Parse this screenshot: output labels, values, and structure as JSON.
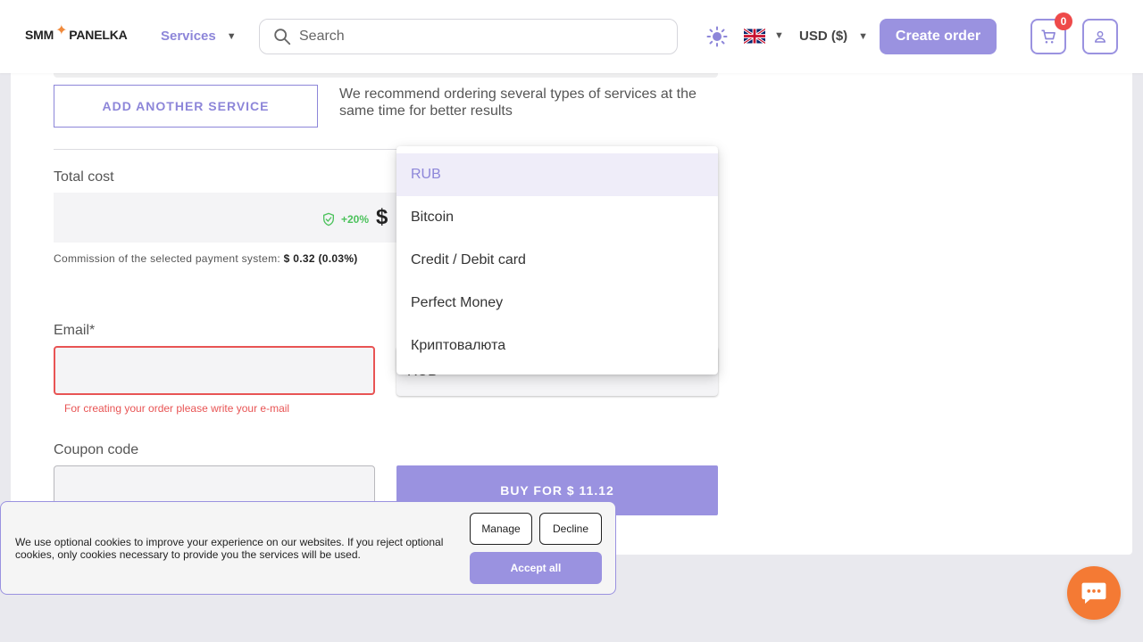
{
  "header": {
    "logo_left": "SMM",
    "logo_right": "PANELKA",
    "services_label": "Services",
    "search_placeholder": "Search",
    "currency_label": "USD ($)",
    "create_order_label": "Create order",
    "cart_count": "0"
  },
  "order": {
    "add_service_label": "ADD ANOTHER SERVICE",
    "recommend_text": "We recommend ordering several types of services at the same time for better results",
    "total_label": "Total cost",
    "bonus_text": "+20%",
    "total_currency_symbol": "$",
    "commission_prefix": "Commission of the selected payment system: ",
    "commission_value": "$ 0.32 (0.03%)",
    "email_label": "Email*",
    "email_value": "",
    "email_error": "For creating your order please write your e-mail",
    "payment_selected": "RUB",
    "coupon_label": "Coupon code",
    "coupon_value": "",
    "buy_label": "BUY FOR $ 11.12"
  },
  "payment_dropdown": {
    "options": [
      "RUB",
      "Bitcoin",
      "Credit / Debit card",
      "Perfect Money",
      "Криптовалюта"
    ],
    "selected_index": 0
  },
  "cookie_banner": {
    "text": "We use optional cookies to improve your experience on our websites. If you reject optional cookies, only cookies necessary to provide you the services will be used.",
    "manage_label": "Manage",
    "decline_label": "Decline",
    "accept_label": "Accept all"
  },
  "icons": {
    "logo": "star-icon",
    "services_chevron": "chevron-down-icon",
    "search": "search-icon",
    "theme": "sun-icon",
    "language": "uk-flag-icon",
    "cart": "cart-icon",
    "user": "user-icon",
    "bonus": "shield-check-icon",
    "chat": "chat-icon"
  },
  "colors": {
    "accent": "#9a92e0",
    "accent_text": "#8d86d9",
    "error": "#e85454",
    "bonus": "#4cc25c",
    "chat": "#f47a34",
    "badge": "#ee4a4a"
  }
}
